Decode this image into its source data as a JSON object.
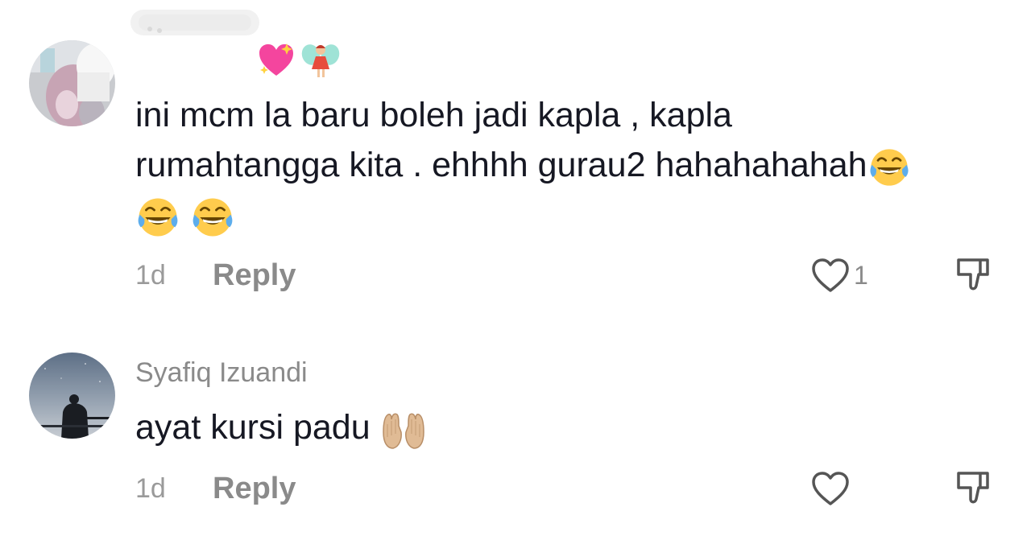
{
  "comments": [
    {
      "username": "",
      "username_emojis": [
        "sparkling-heart",
        "fairy"
      ],
      "text_line_1": "ini mcm la baru boleh jadi kapla , kapla",
      "text_line_2": "rumahtangga kita . ehhhh gurau2 hahahahahah",
      "trailing_emojis": [
        "tears-of-joy",
        "tears-of-joy",
        "tears-of-joy"
      ],
      "time": "1d",
      "reply_label": "Reply",
      "like_count": "1"
    },
    {
      "username": "Syafiq Izuandi",
      "text": "ayat kursi padu",
      "trailing_emojis": [
        "palms-up-together"
      ],
      "time": "1d",
      "reply_label": "Reply",
      "like_count": ""
    }
  ],
  "colors": {
    "text": "#161823",
    "muted": "#8a8a8a",
    "icon": "#555555"
  }
}
